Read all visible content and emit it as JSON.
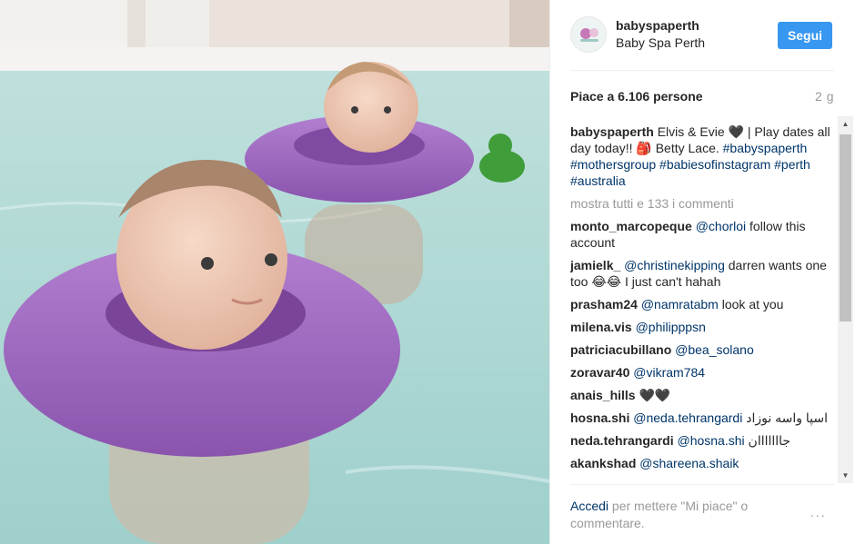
{
  "post": {
    "username": "babyspaperth",
    "full_name": "Baby Spa Perth",
    "follow_label": "Segui",
    "likes": "Piace a 6.106 persone",
    "time": "2 g",
    "caption_user": "babyspaperth",
    "caption_text": "Elvis & Evie 🖤 | Play dates all day today!! 🎒 Betty Lace.",
    "caption_tags": "#babyspaperth #mothersgroup #babiesofinstagram #perth #australia",
    "show_all": "mostra tutti e 133 i commenti"
  },
  "comments": [
    {
      "user": "monto_marcopeque",
      "mention": "@chorloi",
      "text": " follow this account"
    },
    {
      "user": "jamielk_",
      "mention": "@christinekipping",
      "text": " darren wants one too 😂😂 I just can't hahah"
    },
    {
      "user": "prasham24",
      "mention": "@namratabm",
      "text": " look at you"
    },
    {
      "user": "milena.vis",
      "mention": "@philipppsn",
      "text": ""
    },
    {
      "user": "patriciacubillano",
      "mention": "@bea_solano",
      "text": ""
    },
    {
      "user": "zoravar40",
      "mention": "@vikram784",
      "text": ""
    },
    {
      "user": "anais_hills",
      "mention": "",
      "text": " 🖤🖤"
    },
    {
      "user": "hosna.shi",
      "mention": "@neda.tehrangardi",
      "text": " اسپا واسه نوزاد"
    },
    {
      "user": "neda.tehrangardi",
      "mention": "@hosna.shi",
      "text": " جااااااان"
    },
    {
      "user": "akankshad",
      "mention": "@shareena.shaik",
      "text": ""
    }
  ],
  "footer": {
    "login_link": "Accedi",
    "login_text": " per mettere \"Mi piace\" o commentare.",
    "more_options": "..."
  },
  "icons": {
    "scroll_up": "▲",
    "scroll_down": "▼"
  },
  "colors": {
    "accent": "#3897f0",
    "link": "#003569",
    "muted": "#999999"
  }
}
